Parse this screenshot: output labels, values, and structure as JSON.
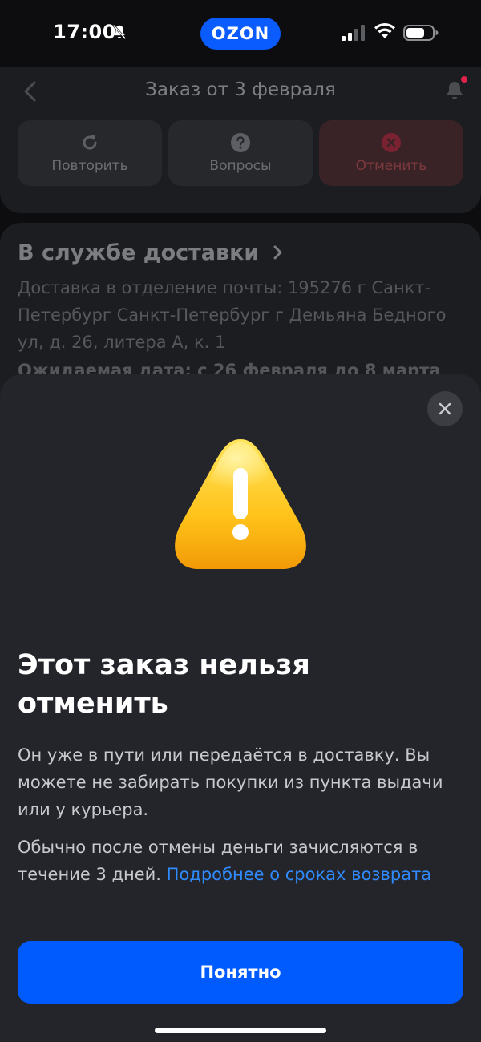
{
  "status_bar": {
    "time": "17:00",
    "brand": "OZON"
  },
  "header": {
    "title": "Заказ от 3 февраля"
  },
  "actions": [
    {
      "label": "Повторить",
      "icon": "refresh-icon"
    },
    {
      "label": "Вопросы",
      "icon": "question-icon"
    },
    {
      "label": "Отменить",
      "icon": "cancel-icon"
    }
  ],
  "delivery": {
    "title": "В службе доставки",
    "address": "Доставка в отделение почты: 195276 г Санкт-Петербург Санкт-Петербург г Демьяна Бедного ул, д. 26, литера А, к. 1",
    "expected": "Ожидаемая дата: с 26 февраля до 8 марта"
  },
  "sheet": {
    "title": "Этот заказ нельзя отменить",
    "paragraph1": "Он уже в пути или передаётся в доставку. Вы можете не забирать покупки из пункта выдачи или у курьера.",
    "paragraph2_text": "Обычно после отмены деньги зачисляются в течение 3 дней.",
    "paragraph2_link": "Подробнее о сроках возврата",
    "button": "Понятно"
  },
  "colors": {
    "accent": "#005bff",
    "link": "#2f8bff",
    "warning": "#ffc21a",
    "cancel": "#e0224e"
  }
}
